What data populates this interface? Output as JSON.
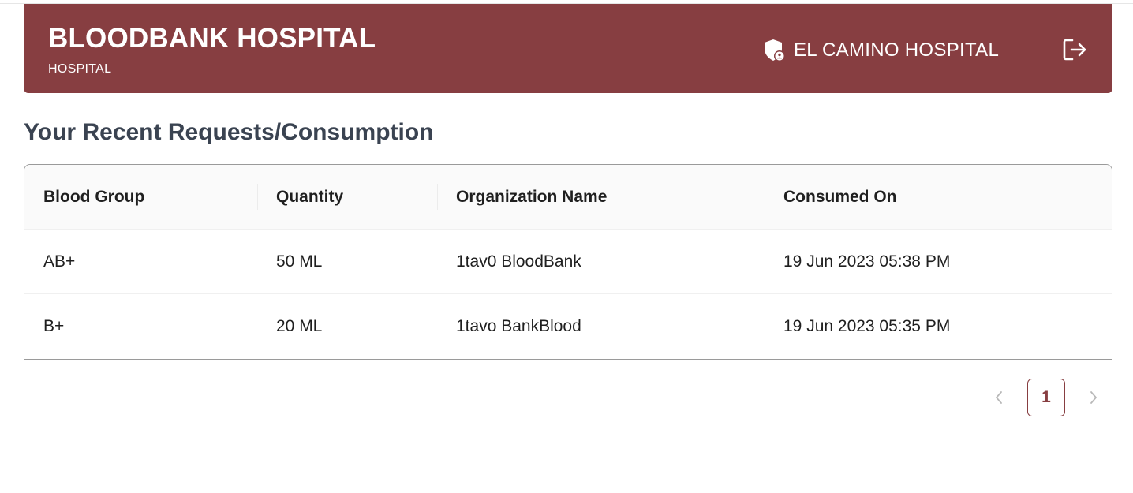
{
  "header": {
    "title": "BLOODBANK HOSPITAL",
    "subtitle": "HOSPITAL",
    "user_icon": "shield-user-icon",
    "user_name": "EL CAMINO HOSPITAL",
    "logout_icon": "logout-icon",
    "background_color": "#873e41"
  },
  "main": {
    "title": "Your Recent Requests/Consumption"
  },
  "table": {
    "columns": [
      "Blood Group",
      "Quantity",
      "Organization Name",
      "Consumed On"
    ],
    "rows": [
      [
        "AB+",
        "50 ML",
        "1tav0 BloodBank",
        "19 Jun 2023 05:38 PM"
      ],
      [
        "B+",
        "20 ML",
        "1tavo BankBlood",
        "19 Jun 2023 05:35 PM"
      ]
    ]
  },
  "pagination": {
    "prev_icon": "chevron-left-icon",
    "current_page": "1",
    "next_icon": "chevron-right-icon"
  }
}
